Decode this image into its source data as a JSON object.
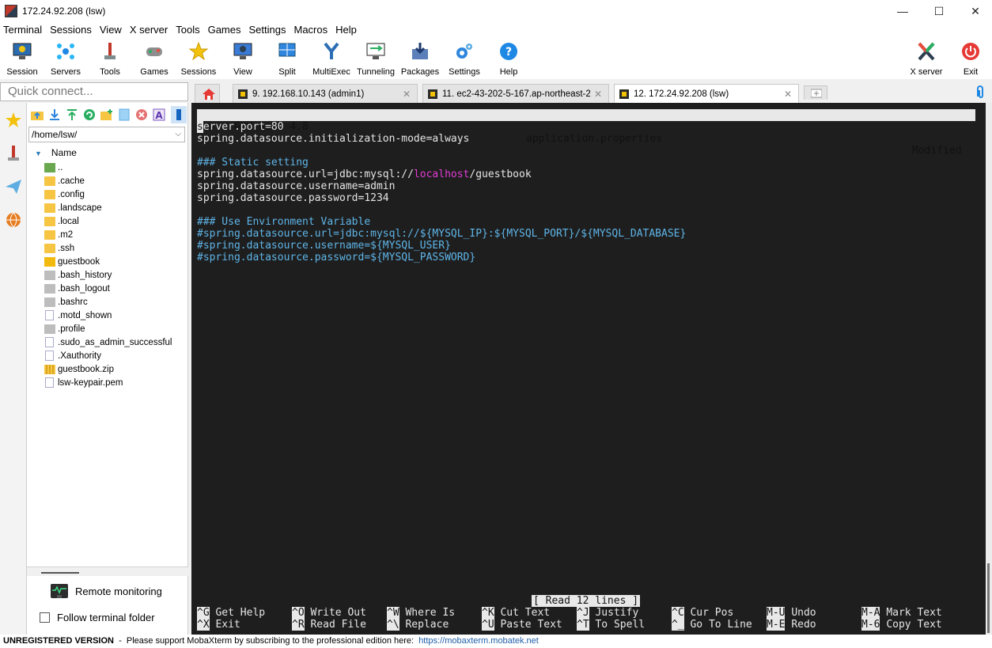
{
  "window": {
    "title": "172.24.92.208 (lsw)",
    "minimize": "—",
    "maximize": "☐",
    "close": "✕"
  },
  "menu": [
    "Terminal",
    "Sessions",
    "View",
    "X server",
    "Tools",
    "Games",
    "Settings",
    "Macros",
    "Help"
  ],
  "toolbar": {
    "session": "Session",
    "servers": "Servers",
    "tools": "Tools",
    "games": "Games",
    "sessions": "Sessions",
    "view": "View",
    "split": "Split",
    "multiexec": "MultiExec",
    "tunneling": "Tunneling",
    "packages": "Packages",
    "settings": "Settings",
    "help": "Help",
    "xserver": "X server",
    "exit": "Exit"
  },
  "quick_connect": {
    "placeholder": "Quick connect..."
  },
  "file_browser": {
    "path": "/home/lsw/",
    "column": "Name",
    "items": [
      {
        "name": "..",
        "type": "up"
      },
      {
        "name": ".cache",
        "type": "folder"
      },
      {
        "name": ".config",
        "type": "folder"
      },
      {
        "name": ".landscape",
        "type": "folder"
      },
      {
        "name": ".local",
        "type": "folder"
      },
      {
        "name": ".m2",
        "type": "folder"
      },
      {
        "name": ".ssh",
        "type": "folder"
      },
      {
        "name": "guestbook",
        "type": "folder-dark"
      },
      {
        "name": ".bash_history",
        "type": "file-gray"
      },
      {
        "name": ".bash_logout",
        "type": "file-gray"
      },
      {
        "name": ".bashrc",
        "type": "file-gray"
      },
      {
        "name": ".motd_shown",
        "type": "file-white"
      },
      {
        "name": ".profile",
        "type": "file-gray"
      },
      {
        "name": ".sudo_as_admin_successful",
        "type": "file-white"
      },
      {
        "name": ".Xauthority",
        "type": "file-white"
      },
      {
        "name": "guestbook.zip",
        "type": "zip"
      },
      {
        "name": "lsw-keypair.pem",
        "type": "file-white"
      }
    ],
    "remote_monitoring": "Remote monitoring",
    "follow_terminal": "Follow terminal folder"
  },
  "tabs": [
    {
      "label": "9. 192.168.10.143 (admin1)",
      "close": "✕"
    },
    {
      "label": "11. ec2-43-202-5-167.ap-northeast-2",
      "close": "✕"
    },
    {
      "label": "12. 172.24.92.208 (lsw)",
      "close": "✕"
    }
  ],
  "nano": {
    "version": "  GNU nano 4.8",
    "filename": "application.properties",
    "modified": "Modified",
    "line1_cursor": "s",
    "line1_rest": "erver.port=80",
    "line2": "spring.datasource.initialization-mode=always",
    "comment1": "### Static setting",
    "url_prefix": "spring.datasource.url=jdbc:mysql://",
    "url_host": "localhost",
    "url_suffix": "/guestbook",
    "username": "spring.datasource.username=admin",
    "password": "spring.datasource.password=1234",
    "comment2": "### Use Environment Variable",
    "env_url": "#spring.datasource.url=jdbc:mysql://${MYSQL_IP}:${MYSQL_PORT}/${MYSQL_DATABASE}",
    "env_user": "#spring.datasource.username=${MYSQL_USER}",
    "env_pass": "#spring.datasource.password=${MYSQL_PASSWORD}",
    "status": "[ Read 12 lines ]",
    "shortcuts": [
      {
        "k1": "^G",
        "l1": "Get Help",
        "k2": "^X",
        "l2": "Exit"
      },
      {
        "k1": "^O",
        "l1": "Write Out",
        "k2": "^R",
        "l2": "Read File"
      },
      {
        "k1": "^W",
        "l1": "Where Is",
        "k2": "^\\",
        "l2": "Replace"
      },
      {
        "k1": "^K",
        "l1": "Cut Text",
        "k2": "^U",
        "l2": "Paste Text"
      },
      {
        "k1": "^J",
        "l1": "Justify",
        "k2": "^T",
        "l2": "To Spell"
      },
      {
        "k1": "^C",
        "l1": "Cur Pos",
        "k2": "^_",
        "l2": "Go To Line"
      },
      {
        "k1": "M-U",
        "l1": "Undo",
        "k2": "M-E",
        "l2": "Redo"
      },
      {
        "k1": "M-A",
        "l1": "Mark Text",
        "k2": "M-6",
        "l2": "Copy Text"
      }
    ]
  },
  "footer": {
    "unregistered": "UNREGISTERED VERSION",
    "message": "  -  Please support MobaXterm by subscribing to the professional edition here:  ",
    "link": "https://mobaxterm.mobatek.net"
  },
  "colors": {
    "terminal_bg": "#1e1e1e",
    "comment": "#5fb5e8",
    "highlight": "#e23bd4"
  }
}
